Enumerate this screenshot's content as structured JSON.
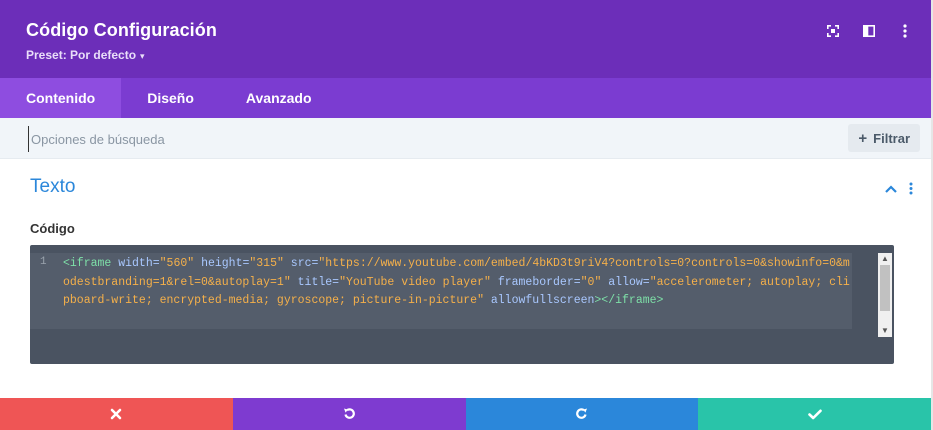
{
  "header": {
    "title": "Código Configuración",
    "preset_label": "Preset: Por defecto",
    "icons": [
      "expand-icon",
      "sidebar-layout-icon",
      "more-vertical-icon"
    ]
  },
  "tabs": [
    {
      "label": "Contenido",
      "active": true
    },
    {
      "label": "Diseño",
      "active": false
    },
    {
      "label": "Avanzado",
      "active": false
    }
  ],
  "search": {
    "placeholder": "Opciones de búsqueda",
    "value": "",
    "filter_label": "Filtrar"
  },
  "section": {
    "title": "Texto",
    "field_label": "Código"
  },
  "editor": {
    "line_number": "1",
    "tokens": {
      "t1": "<iframe",
      "a1": "width=",
      "v1": "\"560\"",
      "a2": "height=",
      "v2": "\"315\"",
      "a3": "src=",
      "v3": "\"https://www.youtube.com/embed/4bKD3t9riV4?controls=0?controls=0&showinfo=0&modestbranding=1&rel=0&autoplay=1\"",
      "a4": "title=",
      "v4": "\"YouTube video player\"",
      "a5": "frameborder=",
      "v5": "\"0\"",
      "a6": "allow=",
      "v6": "\"accelerometer; autoplay; clipboard-write; encrypted-media; gyroscope; picture-in-picture\"",
      "a7": "allowfullscreen",
      "t2": "></iframe>"
    }
  },
  "footer": {
    "buttons": [
      "close-icon",
      "undo-icon",
      "redo-icon",
      "check-icon"
    ]
  },
  "colors": {
    "header_bg": "#6c2eb9",
    "tabs_bg": "#7b3cd1",
    "accent_blue": "#2b87da",
    "cancel": "#ef5555",
    "undo": "#7e3bd0",
    "redo": "#2b87da",
    "save": "#29c4a9"
  }
}
